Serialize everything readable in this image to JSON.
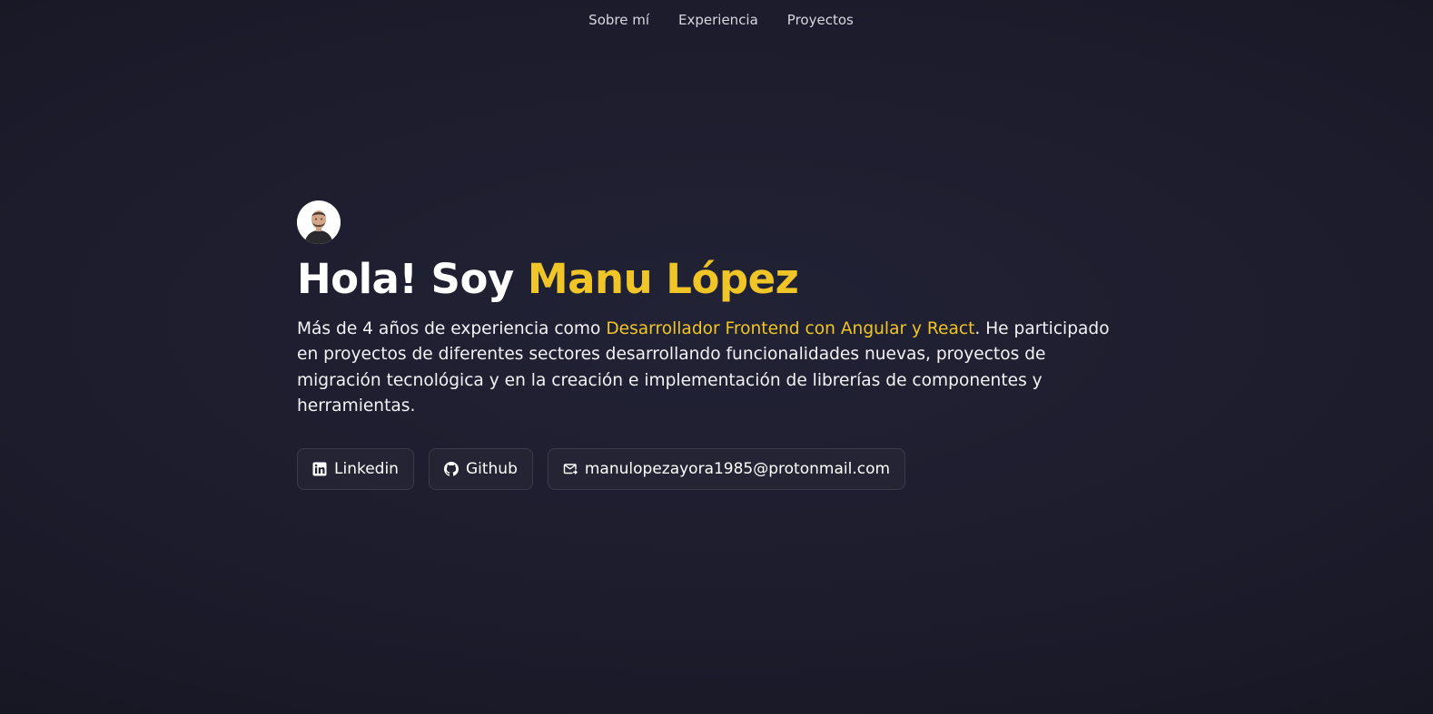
{
  "nav": {
    "items": [
      {
        "label": "Sobre mí"
      },
      {
        "label": "Experiencia"
      },
      {
        "label": "Proyectos"
      }
    ]
  },
  "hero": {
    "avatar_alt": "avatar",
    "title_prefix": "Hola! Soy ",
    "title_name": "Manu López",
    "bio_before": "Más de 4 años de experiencia como ",
    "bio_highlight": "Desarrollador Frontend con Angular y React",
    "bio_after": ". He participado en proyectos de diferentes sectores desarrollando funcionalidades nuevas, proyectos de migración tecnológica y en la creación e implementación de librerías de componentes y herramientas."
  },
  "links": {
    "linkedin": {
      "label": "Linkedin",
      "icon": "linkedin-icon"
    },
    "github": {
      "label": "Github",
      "icon": "github-icon"
    },
    "email": {
      "label": "manulopezayora1985@protonmail.com",
      "icon": "mail-icon"
    }
  },
  "colors": {
    "accent": "#f0c528",
    "background": "#1c1c2c",
    "text": "#ffffff"
  }
}
